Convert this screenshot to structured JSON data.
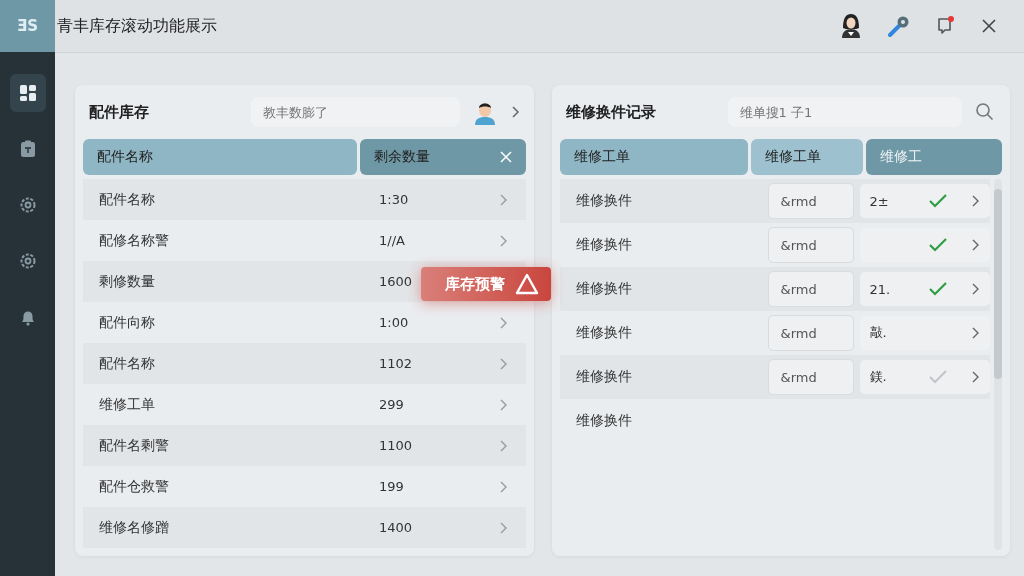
{
  "window": {
    "logo": "ƎS",
    "title": "青丰库存滚动功能展示"
  },
  "sidebar": {
    "items": [
      {
        "selected": true
      },
      {
        "selected": false
      },
      {
        "selected": false
      },
      {
        "selected": false
      },
      {
        "selected": false
      }
    ]
  },
  "inventory": {
    "title": "配件库存",
    "search": {
      "placeholder": "教丰数膨了"
    },
    "columns": [
      "配件名称",
      "剩余数量"
    ],
    "rows": [
      {
        "name": "配件名称",
        "qty": "1:30"
      },
      {
        "name": "配修名称警",
        "qty": "1//A"
      },
      {
        "name": "剩修数量",
        "qty": "1600"
      },
      {
        "name": "配件向称",
        "qty": "1:00"
      },
      {
        "name": "配件名称",
        "qty": "1102"
      },
      {
        "name": "维修工单",
        "qty": "299"
      },
      {
        "name": "配件名剩警",
        "qty": "1100"
      },
      {
        "name": "配件仓救警",
        "qty": "199"
      },
      {
        "name": "维修名修蹭",
        "qty": "1400"
      }
    ]
  },
  "alert": {
    "label": "库存预警"
  },
  "records": {
    "title": "维修换件记录",
    "search": {
      "placeholder": "维单搜1 子1"
    },
    "columns": [
      "维修工单",
      "维修工单",
      "维修工"
    ],
    "rows": [
      {
        "name": "维修换件",
        "order": "&rmd",
        "worker": "2±",
        "checked": true
      },
      {
        "name": "维修换件",
        "order": "&rmd",
        "checked": true
      },
      {
        "name": "维修换件",
        "order": "&rmd",
        "worker": "21.",
        "checked": true
      },
      {
        "name": "维修换件",
        "order": "&rmd",
        "worker": "敲."
      },
      {
        "name": "维修换件",
        "order": "&rmd",
        "worker": "鎂.",
        "checked": false
      },
      {
        "name": "维修换件"
      }
    ]
  }
}
